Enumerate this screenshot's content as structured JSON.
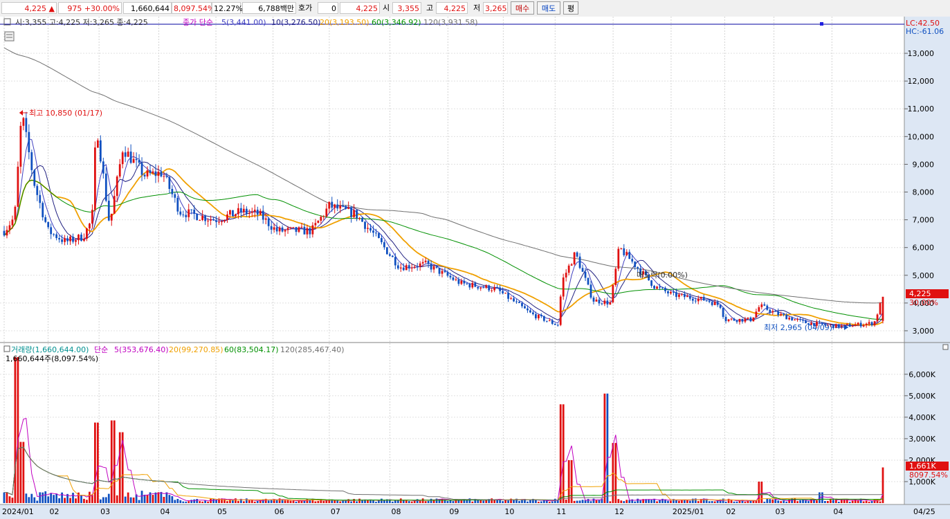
{
  "topbar": {
    "price": "4,225",
    "change": "975",
    "change_pct": "+30.00%",
    "volume": "1,660,644",
    "volume_ratio": "8,097.54%",
    "turnover_pct": "12.27%",
    "amount": "6,788백만",
    "hoga_label": "호가",
    "hoga_value": "0",
    "hoga_price": "4,225",
    "open_label": "시",
    "open_value": "3,355",
    "high_label": "고",
    "high_value": "4,225",
    "low_label": "저",
    "low_value": "3,265",
    "buy_label": "매수",
    "sell_label": "매도",
    "avg_label": "평"
  },
  "price_panel": {
    "info_text": "시:3,355 고:4,225 저:3,265 종:4,225",
    "ma_label": "종가 단순",
    "ma_legend": [
      {
        "text": "5(3,441.00)",
        "color": "#4040c0"
      },
      {
        "text": "10(3,276.50)",
        "color": "#202080"
      },
      {
        "text": "20(3,193.50)",
        "color": "#f0a000"
      },
      {
        "text": "60(3,346.92)",
        "color": "#009000"
      },
      {
        "text": "120(3,931.58)",
        "color": "#707070"
      }
    ],
    "lc": "LC:42.50",
    "hc": "HC:-61.06",
    "y_ticks": [
      "13,000",
      "12,000",
      "11,000",
      "10,000",
      "9,000",
      "8,000",
      "7,000",
      "6,000",
      "5,000",
      "4,000",
      "3,000"
    ],
    "current_price_badge": "4,225",
    "current_pct": "30.00%",
    "high_marker": "최고 10,850 (01/17)",
    "low_marker": "최저 2,965 (04/09)",
    "cursor_label": "매도락(0.00%)"
  },
  "volume_panel": {
    "legend_label": "거래량(1,660,644.00)",
    "ma_label": "단순",
    "ma_legend": [
      {
        "text": "5(353,676.40)",
        "color": "#c000c0"
      },
      {
        "text": "20(99,270.85)",
        "color": "#f0a000"
      },
      {
        "text": "60(83,504.17)",
        "color": "#009000"
      },
      {
        "text": "120(285,467.40)",
        "color": "#707070"
      }
    ],
    "sub_label": "1,660,644주(8,097.54%)",
    "y_ticks": [
      "6,000K",
      "5,000K",
      "4,000K",
      "3,000K",
      "2,000K",
      "1,000K"
    ],
    "current_badge": "1,661K",
    "current_pct": "8097.54%"
  },
  "x_axis": [
    "2024/01",
    "02",
    "03",
    "04",
    "05",
    "06",
    "07",
    "08",
    "09",
    "10",
    "11",
    "12",
    "2025/01",
    "02",
    "03",
    "04",
    "04/25"
  ],
  "colors": {
    "up": "#e01010",
    "down": "#1050c0",
    "ma5": "#4040c0",
    "ma10": "#202080",
    "ma20": "#f0a000",
    "ma60": "#009000",
    "ma120": "#707070",
    "vol_ma5": "#c000c0"
  },
  "chart_data": {
    "type": "candlestick",
    "price_ylim": [
      2700,
      13600
    ],
    "volume_ylim": [
      0,
      6800000
    ],
    "month_labels": [
      "2024/01",
      "02",
      "03",
      "04",
      "05",
      "06",
      "07",
      "08",
      "09",
      "10",
      "11",
      "12",
      "2025/01",
      "02",
      "03",
      "04"
    ],
    "anchors": [
      {
        "t": 0.0,
        "p": 6600
      },
      {
        "t": 0.012,
        "p": 7100
      },
      {
        "t": 0.02,
        "p": 10850
      },
      {
        "t": 0.035,
        "p": 8200
      },
      {
        "t": 0.05,
        "p": 6600
      },
      {
        "t": 0.07,
        "p": 6200
      },
      {
        "t": 0.09,
        "p": 6400
      },
      {
        "t": 0.1,
        "p": 7000
      },
      {
        "t": 0.105,
        "p": 10500
      },
      {
        "t": 0.12,
        "p": 6800
      },
      {
        "t": 0.135,
        "p": 9600
      },
      {
        "t": 0.16,
        "p": 8600
      },
      {
        "t": 0.18,
        "p": 8700
      },
      {
        "t": 0.2,
        "p": 7300
      },
      {
        "t": 0.24,
        "p": 7000
      },
      {
        "t": 0.27,
        "p": 7300
      },
      {
        "t": 0.29,
        "p": 7200
      },
      {
        "t": 0.31,
        "p": 6600
      },
      {
        "t": 0.35,
        "p": 6600
      },
      {
        "t": 0.37,
        "p": 7500
      },
      {
        "t": 0.4,
        "p": 7200
      },
      {
        "t": 0.42,
        "p": 6500
      },
      {
        "t": 0.45,
        "p": 5300
      },
      {
        "t": 0.48,
        "p": 5400
      },
      {
        "t": 0.52,
        "p": 4700
      },
      {
        "t": 0.56,
        "p": 4500
      },
      {
        "t": 0.6,
        "p": 3600
      },
      {
        "t": 0.63,
        "p": 3200
      },
      {
        "t": 0.635,
        "p": 4800
      },
      {
        "t": 0.65,
        "p": 5800
      },
      {
        "t": 0.67,
        "p": 4100
      },
      {
        "t": 0.69,
        "p": 4000
      },
      {
        "t": 0.7,
        "p": 6000
      },
      {
        "t": 0.72,
        "p": 5300
      },
      {
        "t": 0.74,
        "p": 4600
      },
      {
        "t": 0.76,
        "p": 4300
      },
      {
        "t": 0.8,
        "p": 4100
      },
      {
        "t": 0.815,
        "p": 3900
      },
      {
        "t": 0.82,
        "p": 3400
      },
      {
        "t": 0.85,
        "p": 3400
      },
      {
        "t": 0.86,
        "p": 3900
      },
      {
        "t": 0.88,
        "p": 3600
      },
      {
        "t": 0.91,
        "p": 3300
      },
      {
        "t": 0.95,
        "p": 3150
      },
      {
        "t": 0.99,
        "p": 3280
      },
      {
        "t": 1.0,
        "p": 4225
      }
    ],
    "ma120_start": 13200,
    "volume_spikes": [
      {
        "t": 0.015,
        "v": 6800000
      },
      {
        "t": 0.02,
        "v": 2850000
      },
      {
        "t": 0.105,
        "v": 3750000
      },
      {
        "t": 0.123,
        "v": 3850000
      },
      {
        "t": 0.133,
        "v": 3300000
      },
      {
        "t": 0.635,
        "v": 4600000
      },
      {
        "t": 0.645,
        "v": 2000000
      },
      {
        "t": 0.685,
        "v": 5100000
      },
      {
        "t": 0.695,
        "v": 2800000
      },
      {
        "t": 0.86,
        "v": 1000000
      },
      {
        "t": 0.93,
        "v": 500000
      },
      {
        "t": 1.0,
        "v": 1661000
      }
    ],
    "last": {
      "open": 3355,
      "high": 4225,
      "low": 3265,
      "close": 4225,
      "volume": 1660644
    }
  }
}
